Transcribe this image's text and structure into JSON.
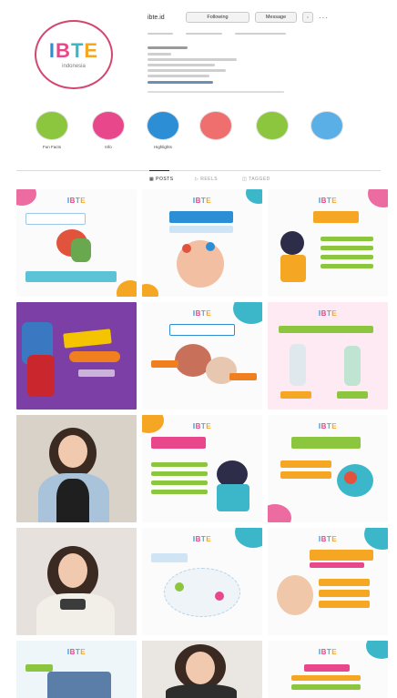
{
  "profile": {
    "username": "ibte.id",
    "logo_text": "IBTE",
    "logo_sub": "indonesia",
    "follow_button": "Following",
    "message_button": "Message"
  },
  "highlights": [
    {
      "label": "Fun Facts",
      "color": "#8cc63f"
    },
    {
      "label": "Info",
      "color": "#e8478b"
    },
    {
      "label": "Highlights",
      "color": "#2c8fd6"
    },
    {
      "label": "",
      "color": "#ef6f6f"
    },
    {
      "label": "",
      "color": "#8cc63f"
    },
    {
      "label": "",
      "color": "#5ab0e6"
    }
  ],
  "tabs": [
    "POSTS",
    "REELS",
    "TAGGED"
  ],
  "colors": {
    "blue": "#2c8fd6",
    "pink": "#e8478b",
    "teal": "#3cb7c9",
    "orange": "#f5a623",
    "purple": "#7b3fa5"
  }
}
